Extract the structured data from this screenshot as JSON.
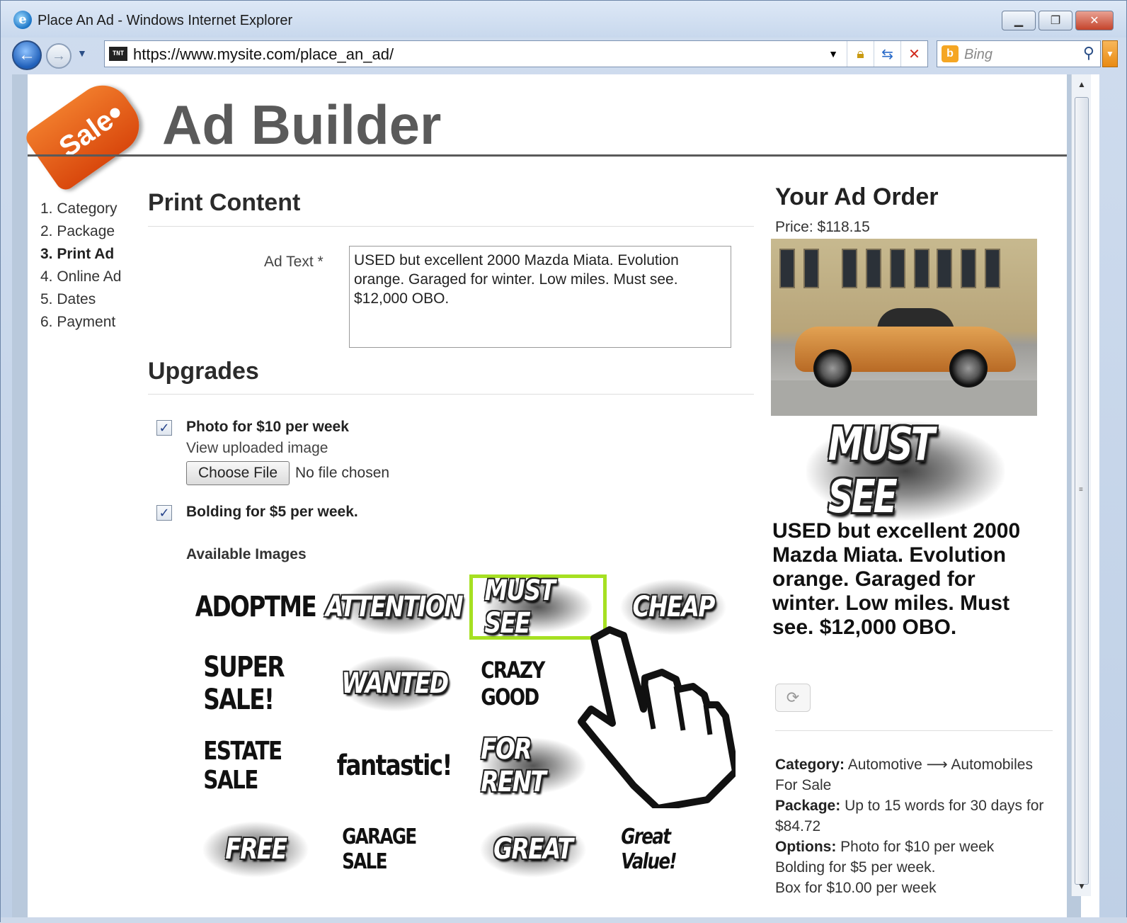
{
  "browser": {
    "title": "Place An Ad - Windows Internet Explorer",
    "url": "https://www.mysite.com/place_an_ad/",
    "search_placeholder": "Bing",
    "site_icon_text": "TNT"
  },
  "header": {
    "tag_text": "Sale",
    "title": "Ad Builder"
  },
  "steps": [
    {
      "label": "1. Category"
    },
    {
      "label": "2. Package"
    },
    {
      "label": "3. Print Ad"
    },
    {
      "label": "4. Online Ad"
    },
    {
      "label": "5. Dates"
    },
    {
      "label": "6. Payment"
    }
  ],
  "print_content": {
    "heading": "Print Content",
    "ad_text_label": "Ad Text *",
    "ad_text_value": "USED but excellent 2000 Mazda Miata. Evolution orange. Garaged for winter. Low miles. Must see. $12,000 OBO."
  },
  "upgrades": {
    "heading": "Upgrades",
    "photo": {
      "label": "Photo for $10 per week",
      "checked": true,
      "view_link": "View uploaded image"
    },
    "file": {
      "button": "Choose File",
      "status": "No file chosen"
    },
    "bolding": {
      "label": "Bolding for $5 per week.",
      "checked": true
    },
    "available_images_label": "Available Images",
    "images": [
      {
        "text": "ADOPTME"
      },
      {
        "text": "ATTENTION"
      },
      {
        "text": "MUST SEE",
        "selected": true
      },
      {
        "text": "CHEAP"
      },
      {
        "text": "SUPER SALE!"
      },
      {
        "text": "WANTED"
      },
      {
        "text": "CRAZY GOOD"
      },
      {
        "text": ""
      },
      {
        "text": "ESTATE SALE"
      },
      {
        "text": "fantastic!"
      },
      {
        "text": "FOR RENT"
      },
      {
        "text": ""
      },
      {
        "text": "FREE"
      },
      {
        "text": "GARAGE SALE"
      },
      {
        "text": "GREAT"
      },
      {
        "text": "Great Value!"
      }
    ]
  },
  "order": {
    "heading": "Your Ad Order",
    "price": "Price: $118.15",
    "banner_text": "MUST SEE",
    "preview_text": "USED but excellent 2000 Mazda Miata. Evolution orange. Garaged for winter. Low miles. Must see. $12,000 OBO.",
    "category_label": "Category:",
    "category_value": "Automotive ⟶ Automobiles For Sale",
    "package_label": "Package:",
    "package_value": "Up to 15 words for 30 days for $84.72",
    "options_label": "Options:",
    "options_lines": [
      "Photo for $10 per week",
      "Bolding for $5 per week.",
      "Box for $10.00 per week"
    ]
  },
  "colors": {
    "accent_selected": "#a6e022",
    "tag_orange": "#e8601c",
    "title_gray": "#5a5a5a"
  }
}
